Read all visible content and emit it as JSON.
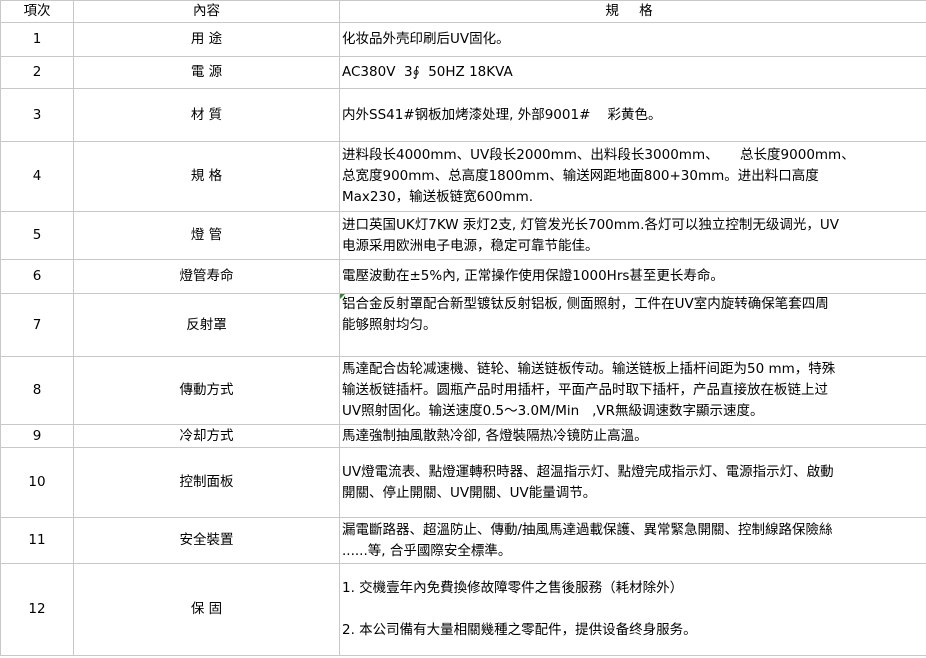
{
  "header": {
    "col1": "項次",
    "col2": "內容",
    "col3": "規 格"
  },
  "rows": [
    {
      "no": "1",
      "item": "用 途",
      "spec": [
        "化妆品外壳印刷后UV固化。"
      ]
    },
    {
      "no": "2",
      "item": "電 源",
      "spec": [
        "AC380V  3∮  50HZ 18KVA"
      ]
    },
    {
      "no": "3",
      "item": "材 質",
      "spec": [
        "内外SS41#钢板加烤漆处理, 外部9001#    彩黄色。"
      ]
    },
    {
      "no": "4",
      "item": "規 格",
      "spec": [
        "进料段长4000mm、UV段长2000mm、出料段长3000mm、     总长度9000mm、",
        "总宽度900mm、总高度1800mm、输送网距地面800+30mm。进出料口高度",
        "Max230，输送板链宽600mm."
      ]
    },
    {
      "no": "5",
      "item": "燈 管",
      "spec": [
        "进口英国UK灯7KW 汞灯2支, 灯管发光长700mm.各灯可以独立控制无级调光，UV",
        "电源采用欧洲电子电源，稳定可靠节能佳。"
      ]
    },
    {
      "no": "6",
      "item": "燈管寿命",
      "spec": [
        "電壓波動在±5%內, 正常操作使用保證1000Hrs甚至更长寿命。"
      ]
    },
    {
      "no": "7",
      "item": "反射罩",
      "spec": [
        "铝合金反射罩配合新型镀钛反射铝板, 侧面照射，工件在UV室内旋转确保笔套四周",
        "能够照射均匀。"
      ]
    },
    {
      "no": "8",
      "item": "傳動方式",
      "spec": [
        "馬達配合齿轮减速機、链轮、输送链板传动。输送链板上插杆间距为50 mm，特殊",
        "输送板链插杆。圆瓶产品时用插杆，平面产品时取下插杆，产品直接放在板链上过",
        "UV照射固化。输送速度0.5～3.0M/Min   ,VR無級调速数字顯示速度。"
      ]
    },
    {
      "no": "9",
      "item": "冷却方式",
      "spec": [
        "馬達強制抽風散熱冷卻, 各燈裝隔热冷镜防止高溫。"
      ]
    },
    {
      "no": "10",
      "item": "控制面板",
      "spec": [
        "UV燈電流表、點燈運轉积時器、超温指示灯、點燈完成指示灯、電源指示灯、啟動",
        "開關、停止開關、UV開關、UV能量调节。"
      ]
    },
    {
      "no": "11",
      "item": "安全裝置",
      "spec": [
        "漏電斷路器、超溫防止、傳動/抽風馬達過載保護、異常緊急開關、控制線路保險絲",
        "......等, 合乎國際安全標準。"
      ]
    },
    {
      "no": "12",
      "item": "保 固",
      "spec": [
        "1. 交機壹年內免費換修故障零件之售後服務（耗材除外）",
        "",
        "2. 本公司備有大量相關幾種之零配件，提供设备终身服务。"
      ]
    }
  ]
}
